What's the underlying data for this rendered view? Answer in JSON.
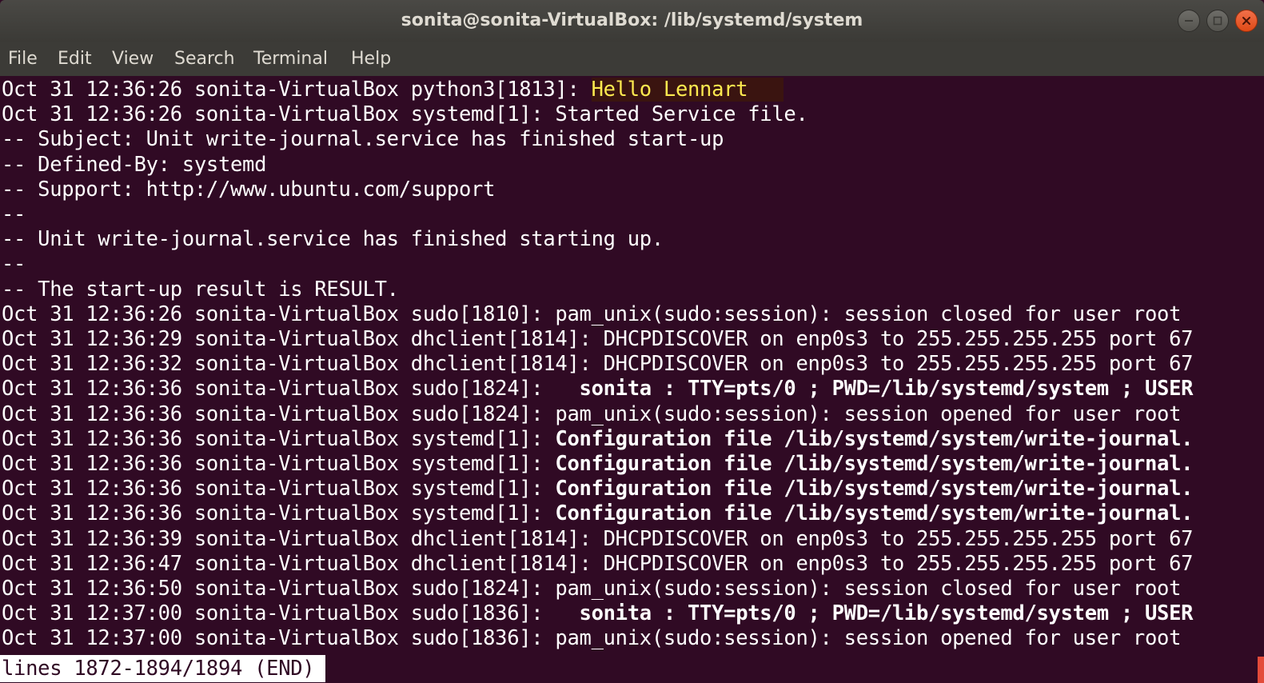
{
  "window": {
    "title": "sonita@sonita-VirtualBox: /lib/systemd/system"
  },
  "menubar": {
    "items": [
      "File",
      "Edit",
      "View",
      "Search",
      "Terminal",
      "Help"
    ]
  },
  "icons": {
    "minimize": "minimize-icon",
    "maximize": "maximize-icon",
    "close": "close-icon"
  },
  "colors": {
    "terminal_bg": "#300a24",
    "terminal_fg": "#ffffff",
    "highlight_fg": "#fce94f",
    "close_button": "#e9541f"
  },
  "log": {
    "lines": [
      {
        "prefix": "Oct 31 12:36:26 sonita-VirtualBox python3[1813]: ",
        "message": "Hello Lennart",
        "style": "highlight"
      },
      {
        "prefix": "Oct 31 12:36:26 sonita-VirtualBox systemd[1]: ",
        "message": "Started Service file.",
        "style": "normal"
      },
      {
        "prefix": "",
        "message": "-- Subject: Unit write-journal.service has finished start-up",
        "style": "normal"
      },
      {
        "prefix": "",
        "message": "-- Defined-By: systemd",
        "style": "normal"
      },
      {
        "prefix": "",
        "message": "-- Support: http://www.ubuntu.com/support",
        "style": "normal"
      },
      {
        "prefix": "",
        "message": "--",
        "style": "normal"
      },
      {
        "prefix": "",
        "message": "-- Unit write-journal.service has finished starting up.",
        "style": "normal"
      },
      {
        "prefix": "",
        "message": "--",
        "style": "normal"
      },
      {
        "prefix": "",
        "message": "-- The start-up result is RESULT.",
        "style": "normal"
      },
      {
        "prefix": "Oct 31 12:36:26 sonita-VirtualBox sudo[1810]: ",
        "message": "pam_unix(sudo:session): session closed for user root",
        "style": "normal"
      },
      {
        "prefix": "Oct 31 12:36:29 sonita-VirtualBox dhclient[1814]: ",
        "message": "DHCPDISCOVER on enp0s3 to 255.255.255.255 port 67",
        "style": "normal"
      },
      {
        "prefix": "Oct 31 12:36:32 sonita-VirtualBox dhclient[1814]: ",
        "message": "DHCPDISCOVER on enp0s3 to 255.255.255.255 port 67",
        "style": "normal"
      },
      {
        "prefix": "Oct 31 12:36:36 sonita-VirtualBox sudo[1824]:   ",
        "message": "sonita : TTY=pts/0 ; PWD=/lib/systemd/system ; USER",
        "style": "bold"
      },
      {
        "prefix": "Oct 31 12:36:36 sonita-VirtualBox sudo[1824]: ",
        "message": "pam_unix(sudo:session): session opened for user root",
        "style": "normal"
      },
      {
        "prefix": "Oct 31 12:36:36 sonita-VirtualBox systemd[1]: ",
        "message": "Configuration file /lib/systemd/system/write-journal.",
        "style": "bold"
      },
      {
        "prefix": "Oct 31 12:36:36 sonita-VirtualBox systemd[1]: ",
        "message": "Configuration file /lib/systemd/system/write-journal.",
        "style": "bold"
      },
      {
        "prefix": "Oct 31 12:36:36 sonita-VirtualBox systemd[1]: ",
        "message": "Configuration file /lib/systemd/system/write-journal.",
        "style": "bold"
      },
      {
        "prefix": "Oct 31 12:36:36 sonita-VirtualBox systemd[1]: ",
        "message": "Configuration file /lib/systemd/system/write-journal.",
        "style": "bold"
      },
      {
        "prefix": "Oct 31 12:36:39 sonita-VirtualBox dhclient[1814]: ",
        "message": "DHCPDISCOVER on enp0s3 to 255.255.255.255 port 67",
        "style": "normal"
      },
      {
        "prefix": "Oct 31 12:36:47 sonita-VirtualBox dhclient[1814]: ",
        "message": "DHCPDISCOVER on enp0s3 to 255.255.255.255 port 67",
        "style": "normal"
      },
      {
        "prefix": "Oct 31 12:36:50 sonita-VirtualBox sudo[1824]: ",
        "message": "pam_unix(sudo:session): session closed for user root",
        "style": "normal"
      },
      {
        "prefix": "Oct 31 12:37:00 sonita-VirtualBox sudo[1836]:   ",
        "message": "sonita : TTY=pts/0 ; PWD=/lib/systemd/system ; USER",
        "style": "bold"
      },
      {
        "prefix": "Oct 31 12:37:00 sonita-VirtualBox sudo[1836]: ",
        "message": "pam_unix(sudo:session): session opened for user root",
        "style": "normal"
      }
    ]
  },
  "status": {
    "text": "lines 1872-1894/1894 (END)"
  }
}
